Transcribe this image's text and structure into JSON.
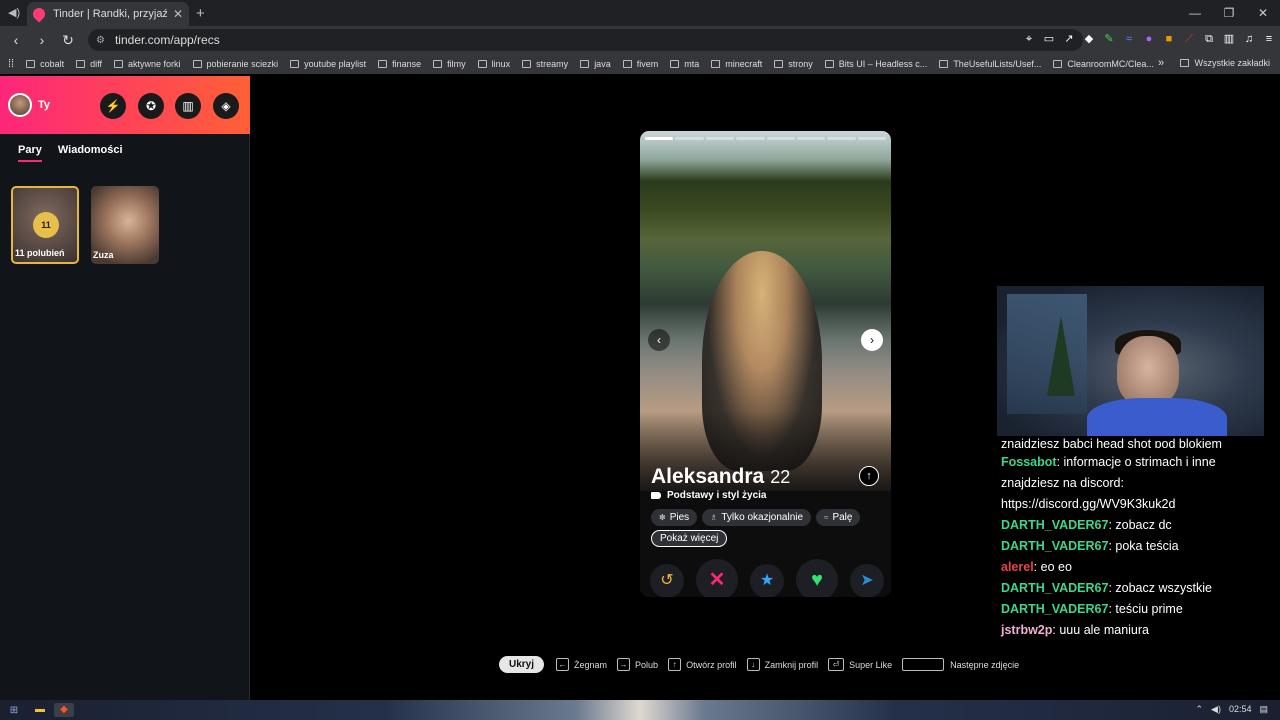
{
  "browser": {
    "tab_title": "Tinder | Randki, przyjaźń, nowe z",
    "url": "tinder.com/app/recs",
    "bookmarks": [
      "cobalt",
      "diff",
      "aktywne forki",
      "pobieranie sciezki",
      "youtube playlist",
      "finanse",
      "filmy",
      "linux",
      "streamy",
      "java",
      "fivem",
      "mta",
      "minecraft",
      "strony",
      "Bits UI – Headless c...",
      "TheUsefulLists/Usef...",
      "CleanroomMC/Clea..."
    ],
    "all_bookmarks": "Wszystkie zakładki"
  },
  "sidebar": {
    "user_name": "Ty",
    "tabs": [
      "Pary",
      "Wiadomości"
    ],
    "likes_count": "11",
    "likes_label": "11 polubień",
    "match_name": "Zuza"
  },
  "profile": {
    "name": "Aleksandra",
    "age": "22",
    "basics": "Podstawy i styl życia",
    "chips": [
      "Pies",
      "Tylko okazjonalnie",
      "Palę"
    ],
    "more": "Pokaż więcej",
    "photo_count": 8,
    "photo_index": 1
  },
  "chat": [
    {
      "user": "",
      "text": "znajdziesz babci head shot pod blokiem",
      "cls": "cut"
    },
    {
      "user": "Fossabot",
      "text": "informacje o strimach i inne znajdziesz na discord: https://discord.gg/WV9K3kuk2d",
      "cls": "u-bot"
    },
    {
      "user": "DARTH_VADER67",
      "text": "zobacz dc",
      "cls": "u-green"
    },
    {
      "user": "DARTH_VADER67",
      "text": "poka teścia",
      "cls": "u-green"
    },
    {
      "user": "alerel",
      "text": "eo eo",
      "cls": "u-red"
    },
    {
      "user": "DARTH_VADER67",
      "text": "zobacz wszystkie",
      "cls": "u-green"
    },
    {
      "user": "DARTH_VADER67",
      "text": "teściu prime",
      "cls": "u-green"
    },
    {
      "user": "jstrbw2p",
      "text": "uuu ale maniura",
      "cls": "u-pink"
    }
  ],
  "hotkeys": {
    "hide": "Ukryj",
    "items": [
      "Żegnam",
      "Polub",
      "Otwórz profil",
      "Zamknij profil",
      "Super Like",
      "Następne zdjęcie"
    ]
  },
  "taskbar": {
    "time": "02:54"
  },
  "colors": {
    "brand_gradient_start": "#fd267a",
    "brand_gradient_end": "#ff6036",
    "like": "#35e26f",
    "superlike": "#2fa9ff",
    "nope": "#fd267a",
    "rewind": "#f3b23c"
  }
}
